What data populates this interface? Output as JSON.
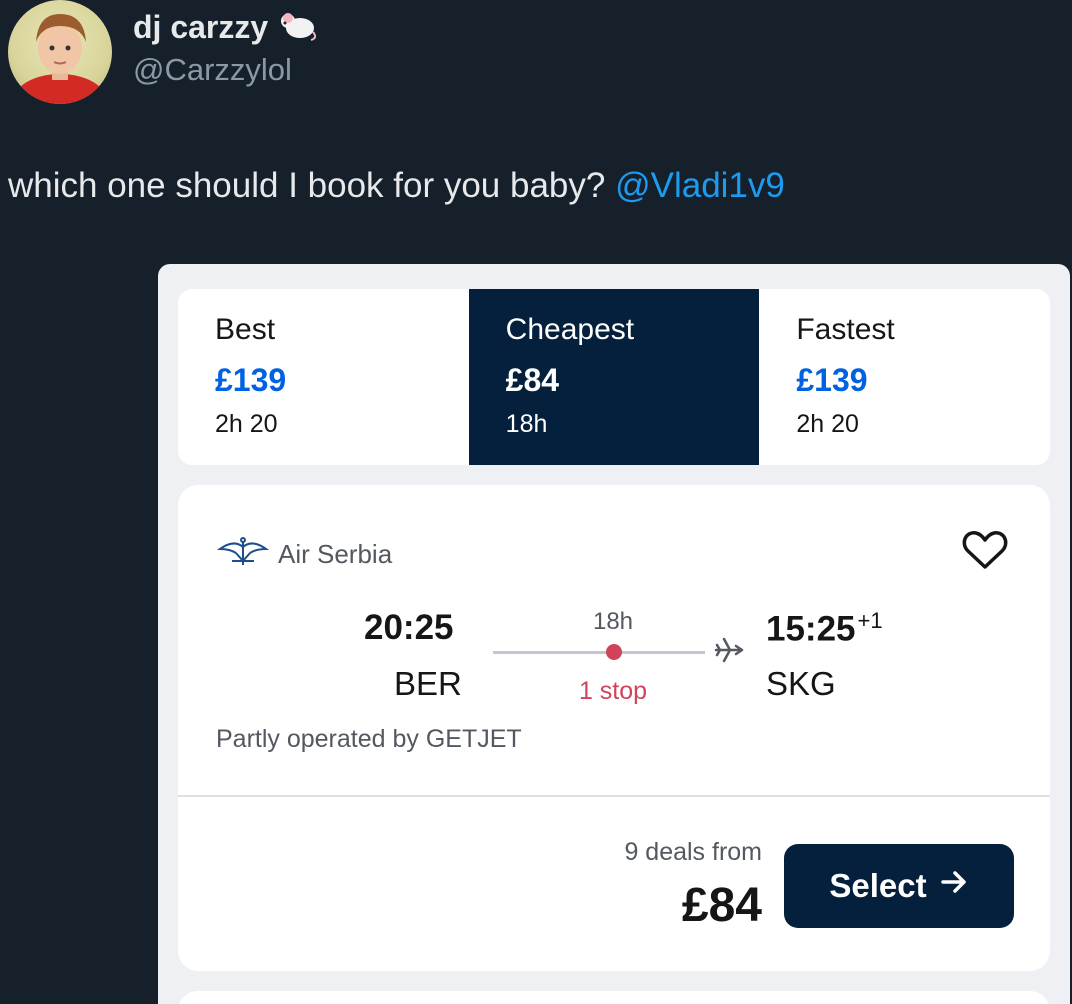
{
  "tweet": {
    "display_name": "dj carzzy",
    "handle": "@Carzzylol",
    "text": "which one should I book for you baby?",
    "mention": "@Vladi1v9"
  },
  "flight_app": {
    "tabs": [
      {
        "label": "Best",
        "price": "£139",
        "duration": "2h 20",
        "active": false
      },
      {
        "label": "Cheapest",
        "price": "£84",
        "duration": "18h",
        "active": true
      },
      {
        "label": "Fastest",
        "price": "£139",
        "duration": "2h 20",
        "active": false
      }
    ],
    "result": {
      "airline": "Air Serbia",
      "departure_time": "20:25",
      "departure_code": "BER",
      "duration": "18h",
      "stops": "1 stop",
      "arrival_time": "15:25",
      "arrival_day_offset": "+1",
      "arrival_code": "SKG",
      "operated_by": "Partly operated by GETJET",
      "deals_label": "9 deals from",
      "price": "£84",
      "select_label": "Select"
    },
    "colors": {
      "navy": "#05203c",
      "price_blue": "#0062e3",
      "stop_pink": "#d1435b",
      "mention_blue": "#1d9bf0"
    }
  }
}
